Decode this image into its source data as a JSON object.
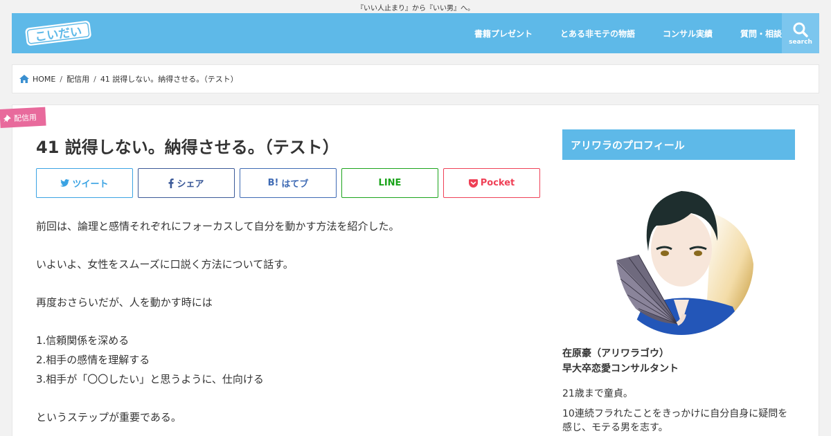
{
  "tagline": "『いい人止まり』から『いい男』へ。",
  "header": {
    "logo_text": "こいだい",
    "nav": [
      "書籍プレゼント",
      "とある非モテの物語",
      "コンサル実績",
      "質問・相談"
    ],
    "search_label": "search"
  },
  "breadcrumb": {
    "home": "HOME",
    "category": "配信用",
    "current": "41 説得しない。納得させる。（テスト）"
  },
  "post": {
    "category_badge": "配信用",
    "title": "41 説得しない。納得させる。（テスト）",
    "share": {
      "twitter": "ツイート",
      "facebook": "シェア",
      "hatena": "はてブ",
      "line": "LINE",
      "pocket": "Pocket"
    },
    "paragraphs": [
      "前回は、論理と感情それぞれにフォーカスして自分を動かす方法を紹介した。",
      "いよいよ、女性をスムーズに口説く方法について話す。",
      "再度おさらいだが、人を動かす時には",
      "1.信頼関係を深める",
      "2.相手の感情を理解する",
      "3.相手が「〇〇したい」と思うように、仕向ける",
      "というステップが重要である。"
    ]
  },
  "sidebar": {
    "profile_heading": "アリワラのプロフィール",
    "name_line1": "在原豪（アリワラゴウ）",
    "name_line2": "早大卒恋愛コンサルタント",
    "bio": [
      "21歳まで童貞。",
      "10連続フラれたことをきっかけに自分自身に疑問を感じ、モテる男を志す。"
    ]
  },
  "colors": {
    "header_bg": "#5eb9e8",
    "badge_bg": "#e86a9c",
    "twitter": "#3aa3e3",
    "facebook": "#3b5998",
    "hatena": "#3e6ab4",
    "line": "#1aa31a",
    "pocket": "#ef4056"
  }
}
